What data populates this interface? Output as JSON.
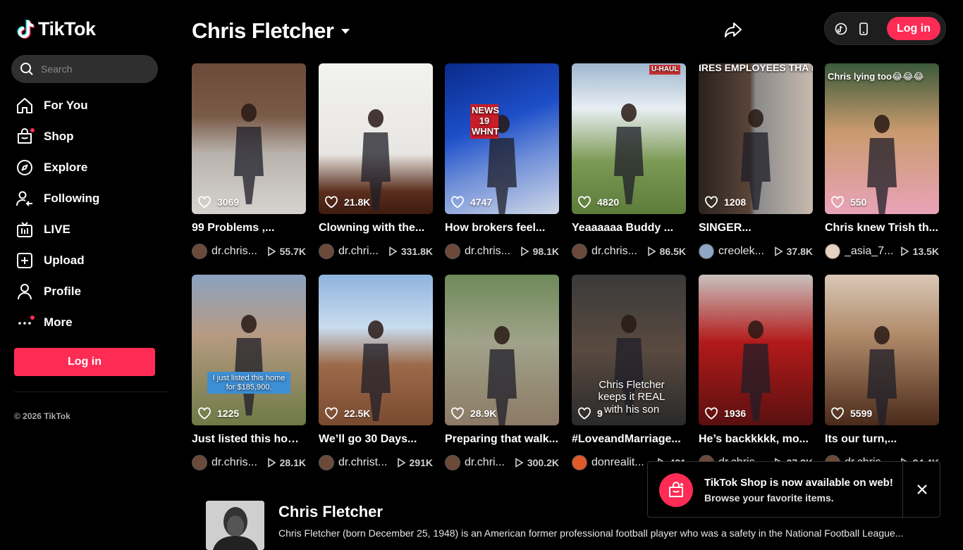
{
  "brand": {
    "name": "TikTok",
    "accent": "#fe2c55"
  },
  "search": {
    "placeholder": "Search"
  },
  "nav": [
    {
      "label": "For You",
      "icon": "home-icon"
    },
    {
      "label": "Shop",
      "icon": "shop-icon"
    },
    {
      "label": "Explore",
      "icon": "compass-icon"
    },
    {
      "label": "Following",
      "icon": "following-icon"
    },
    {
      "label": "LIVE",
      "icon": "live-icon"
    },
    {
      "label": "Upload",
      "icon": "upload-icon"
    },
    {
      "label": "Profile",
      "icon": "profile-icon"
    },
    {
      "label": "More",
      "icon": "more-icon"
    }
  ],
  "sidebar": {
    "login_label": "Log in",
    "copyright": "© 2026 TikTok"
  },
  "header": {
    "title": "Chris Fletcher",
    "login_label": "Log in"
  },
  "videos": [
    {
      "likes": "3069",
      "caption": "99 Problems ,...",
      "user": "dr.chris...",
      "views": "55.7K"
    },
    {
      "likes": "21.8K",
      "caption": "Clowning with the...",
      "user": "dr.chri...",
      "views": "331.8K"
    },
    {
      "likes": "4747",
      "caption": "How brokers feel...",
      "user": "dr.chris...",
      "views": "98.1K",
      "overlay": "NEWS 19 WHNT"
    },
    {
      "likes": "4820",
      "caption": "Yeaaaaaa Buddy ...",
      "user": "dr.chris...",
      "views": "86.5K",
      "overlay": "U-HAUL"
    },
    {
      "likes": "1208",
      "caption": "SINGER...",
      "user": "creolek...",
      "views": "37.8K",
      "overlay": "IRES EMPLOYEES THA FUSE TO SLEEP WITH H"
    },
    {
      "likes": "550",
      "caption": "Chris knew Trish th...",
      "user": "_asia_7...",
      "views": "13.5K",
      "overlay": "Chris lying too😂😂😂"
    },
    {
      "likes": "1225",
      "caption": "Just listed this hom...",
      "user": "dr.chris...",
      "views": "28.1K",
      "overlay": "I just listed this home for $185,900."
    },
    {
      "likes": "22.5K",
      "caption": "We’ll go 30 Days...",
      "user": "dr.christ...",
      "views": "291K"
    },
    {
      "likes": "28.9K",
      "caption": "Preparing that walk...",
      "user": "dr.chri...",
      "views": "300.2K"
    },
    {
      "likes": "9",
      "caption": "#LoveandMarriage...",
      "user": "donrealit...",
      "views": "421",
      "overlay": "Chris Fletcher keeps it REAL with his son"
    },
    {
      "likes": "1936",
      "caption": "He’s backkkkk, mo...",
      "user": "dr.chris...",
      "views": "27.3K"
    },
    {
      "likes": "5599",
      "caption": "Its our turn,...",
      "user": "dr.chris...",
      "views": "84.4K"
    }
  ],
  "bio": {
    "name": "Chris Fletcher",
    "text": "Chris Fletcher (born December 25, 1948) is an American former professional football player who was a safety in the National Football League..."
  },
  "toast": {
    "title": "TikTok Shop is now available on web!",
    "subtitle": "Browse your favorite items."
  }
}
